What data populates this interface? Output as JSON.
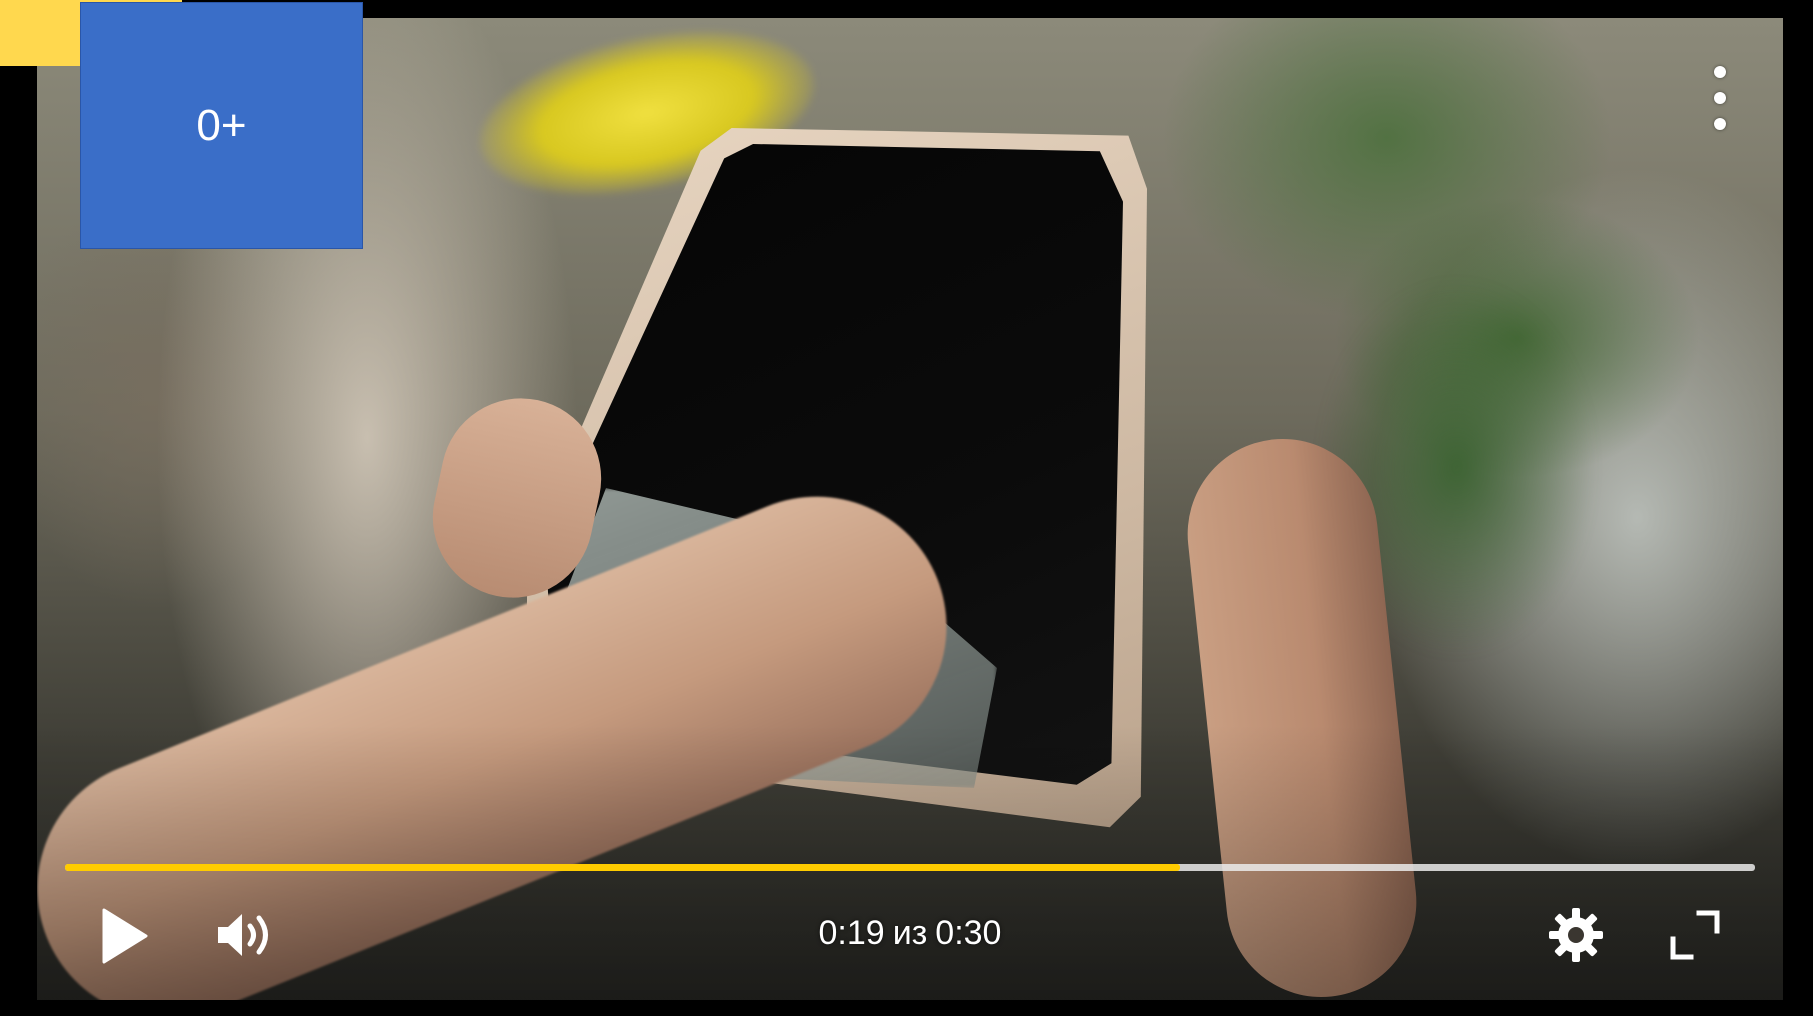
{
  "badge": {
    "age_rating": "0+",
    "accent_color": "#3a6ec8",
    "tab_color": "#ffd84e"
  },
  "top_controls": {
    "menu_icon": "more-vertical-icon"
  },
  "progress": {
    "fraction_played": 0.66,
    "played_color": "#ffcc00",
    "track_color": "#ebebeb"
  },
  "controls": {
    "play_icon": "play-icon",
    "volume_icon": "volume-icon",
    "settings_icon": "gear-icon",
    "fullscreen_icon": "fullscreen-icon",
    "time": {
      "current": "0:19",
      "separator": "из",
      "duration": "0:30"
    }
  }
}
